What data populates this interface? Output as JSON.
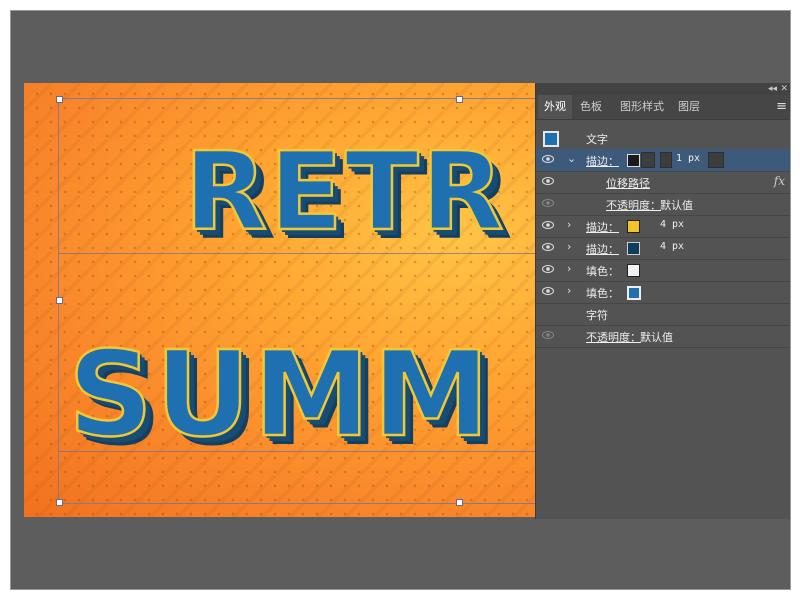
{
  "panel": {
    "tabs": [
      {
        "label": "外观"
      },
      {
        "label": "色板"
      },
      {
        "label": "图形样式"
      },
      {
        "label": "图层"
      }
    ],
    "object_label": "文字",
    "stroke1": {
      "label": "描边：",
      "width": "1 px"
    },
    "offset_path": "位移路径",
    "opacity_row": {
      "label": "不透明度：",
      "value": "默认值"
    },
    "stroke2": {
      "label": "描边：",
      "color": "#f4c22b",
      "width": "4 px"
    },
    "stroke3": {
      "label": "描边：",
      "color": "#0e3d5e",
      "width": "4 px"
    },
    "fill1": {
      "label": "填色：",
      "color": "#f2f2f2"
    },
    "fill2": {
      "label": "填色：",
      "color": "#1f70b0"
    },
    "characters_label": "字符",
    "opacity_row2": {
      "label": "不透明度：",
      "value": "默认值"
    }
  },
  "artboard": {
    "line1": "RETR",
    "line2": "SUMM"
  },
  "colors": {
    "text_fill": "#1f70b0",
    "text_outline": "#f2c832",
    "shadow": "#174d74",
    "bg_orange": "#f9862a"
  },
  "icons": [
    "eye-icon",
    "chevron-down-icon",
    "chevron-right-icon",
    "fx-icon",
    "panel-menu-icon",
    "collapse-icon",
    "close-icon"
  ]
}
